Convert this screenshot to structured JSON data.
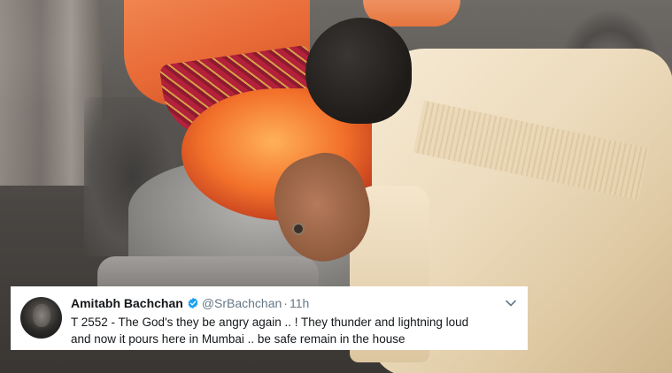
{
  "tweet": {
    "display_name": "Amitabh Bachchan",
    "handle": "@SrBachchan",
    "separator": "·",
    "time": "11h",
    "text_line1": "T 2552 - The God's they be angry again .. ! They thunder and lightning loud",
    "text_line2": "and now it pours here in Mumbai .. be safe remain in the house",
    "verified_icon": "verified-badge-icon",
    "menu_icon": "chevron-down-icon"
  },
  "colors": {
    "verified_blue": "#1da1f2",
    "name_text": "#14171a",
    "meta_text": "#657786",
    "card_background": "#ffffff"
  }
}
